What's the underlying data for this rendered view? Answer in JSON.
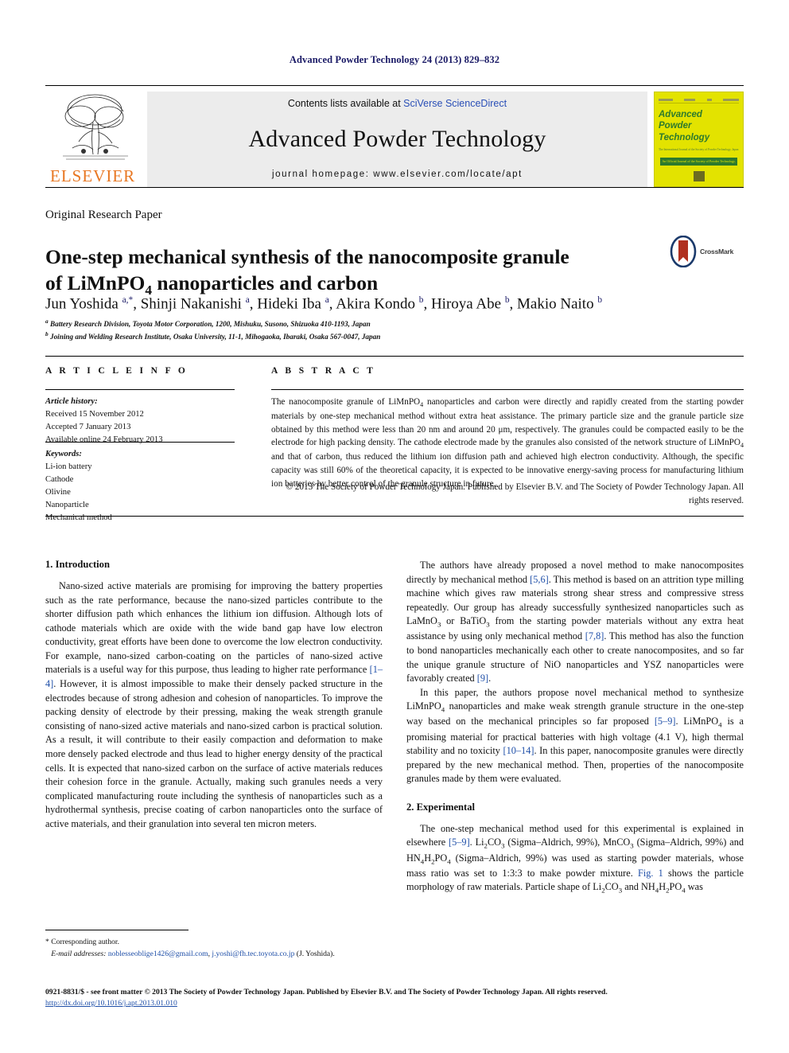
{
  "running_head": "Advanced Powder Technology 24 (2013) 829–832",
  "masthead": {
    "contents_prefix": "Contents lists available at ",
    "contents_link": "SciVerse ScienceDirect",
    "journal_title": "Advanced Powder Technology",
    "homepage": "journal homepage: www.elsevier.com/locate/apt",
    "publisher_logo_text": "ELSEVIER",
    "cover": {
      "title_line1": "Advanced",
      "title_line2": "Powder",
      "title_line3": "Technology",
      "subtitle": "The International Journal of the Society of Powder Technology, Japan",
      "band_text": "An Official Journal of the Society of Powder Technology, Japan"
    }
  },
  "article": {
    "type": "Original Research Paper",
    "title_line1": "One-step mechanical synthesis of the nanocomposite granule",
    "title_line2_a": "of LiMnPO",
    "title_line2_sub": "4",
    "title_line2_b": " nanoparticles and carbon",
    "crossmark_label": "CrossMark",
    "authors": "Jun Yoshida a,*, Shinji Nakanishi a, Hideki Iba a, Akira Kondo b, Hiroya Abe b, Makio Naito b",
    "affiliation_a": "Battery Research Division, Toyota Motor Corporation, 1200, Mishuku, Susono, Shizuoka 410-1193, Japan",
    "affiliation_b": "Joining and Welding Research Institute, Osaka University, 11-1, Mihogaoka, Ibaraki, Osaka 567-0047, Japan"
  },
  "info": {
    "heading": "A R T I C L E  I N F O",
    "history_label": "Article history:",
    "received": "Received 15 November 2012",
    "accepted": "Accepted 7 January 2013",
    "available": "Available online 24 February 2013",
    "keywords_label": "Keywords:",
    "keywords": [
      "Li-ion battery",
      "Cathode",
      "Olivine",
      "Nanoparticle",
      "Mechanical method"
    ]
  },
  "abstract": {
    "heading": "A B S T R A C T",
    "text_part1": "The nanocomposite granule of LiMnPO",
    "text_sub1": "4",
    "text_part2": " nanoparticles and carbon were directly and rapidly created from the starting powder materials by one-step mechanical method without extra heat assistance. The primary particle size and the granule particle size obtained by this method were less than 20 nm and around 20 μm, respectively. The granules could be compacted easily to be the electrode for high packing density. The cathode electrode made by the granules also consisted of the network structure of LiMnPO",
    "text_sub2": "4",
    "text_part3": " and that of carbon, thus reduced the lithium ion diffusion path and achieved high electron conductivity. Although, the specific capacity was still 60% of the theoretical capacity, it is expected to be innovative energy-saving process for manufacturing lithium ion batteries by better control of the granule structure in future.",
    "copyright": "© 2013 The Society of Powder Technology Japan. Published by Elsevier B.V. and The Society of Powder Technology Japan. All rights reserved."
  },
  "body": {
    "section1_heading": "1. Introduction",
    "section1_para1_a": "Nano-sized active materials are promising for improving the battery properties such as the rate performance, because the nano-sized particles contribute to the shorter diffusion path which enhances the lithium ion diffusion. Although lots of cathode materials which are oxide with the wide band gap have low electron conductivity, great efforts have been done to overcome the low electron conductivity. For example, nano-sized carbon-coating on the particles of nano-sized active materials is a useful way for this purpose, thus leading to higher rate performance ",
    "section1_para1_ref": "[1–4]",
    "section1_para1_b": ". However, it is almost impossible to make their densely packed structure in the electrodes because of strong adhesion and cohesion of nanoparticles. To improve the packing density of electrode by their pressing, making the weak strength granule consisting of nano-sized active materials and nano-sized carbon is practical solution. As a result, it will contribute to their easily compaction and deformation to make more densely packed electrode and thus lead to higher energy density of the practical cells. It is expected that nano-sized carbon on the surface of active materials reduces their cohesion force in the granule. Actually, making such granules needs a very complicated manufacturing route including the synthesis of nanoparticles such as a hydrothermal synthesis, precise coating of carbon nanoparticles onto the surface of active materials, and their granulation into several ten micron meters.",
    "right_para1_a": "The authors have already proposed a novel method to make nanocomposites directly by mechanical method ",
    "right_para1_ref1": "[5,6]",
    "right_para1_b": ". This method is based on an attrition type milling machine which gives raw materials strong shear stress and compressive stress repeatedly. Our group has already successfully synthesized nanoparticles such as LaMnO",
    "right_para1_sub1": "3",
    "right_para1_c": " or BaTiO",
    "right_para1_sub2": "3",
    "right_para1_d": " from the starting powder materials without any extra heat assistance by using only mechanical method ",
    "right_para1_ref2": "[7,8]",
    "right_para1_e": ". This method has also the function to bond nanoparticles mechanically each other to create nanocomposites, and so far the unique granule structure of NiO nanoparticles and YSZ nanoparticles were favorably created ",
    "right_para1_ref3": "[9]",
    "right_para1_f": ".",
    "right_para2_a": "In this paper, the authors propose novel mechanical method to synthesize LiMnPO",
    "right_para2_sub1": "4",
    "right_para2_b": " nanoparticles and make weak strength granule structure in the one-step way based on the mechanical principles so far proposed ",
    "right_para2_ref1": "[5–9]",
    "right_para2_c": ". LiMnPO",
    "right_para2_sub2": "4",
    "right_para2_d": " is a promising material for practical batteries with high voltage (4.1 V), high thermal stability and no toxicity ",
    "right_para2_ref2": "[10–14]",
    "right_para2_e": ". In this paper, nanocomposite granules were directly prepared by the new mechanical method. Then, properties of the nanocomposite granules made by them were evaluated.",
    "section2_heading": "2. Experimental",
    "section2_para1_a": "The one-step mechanical method used for this experimental is explained in elsewhere ",
    "section2_para1_ref1": "[5–9]",
    "section2_para1_b": ". Li",
    "section2_para1_sub1": "2",
    "section2_para1_c": "CO",
    "section2_para1_sub2": "3",
    "section2_para1_d": " (Sigma–Aldrich, 99%), MnCO",
    "section2_para1_sub3": "3",
    "section2_para1_e": " (Sigma–Aldrich, 99%) and HN",
    "section2_para1_sub4": "4",
    "section2_para1_f": "H",
    "section2_para1_sub5": "2",
    "section2_para1_g": "PO",
    "section2_para1_sub6": "4",
    "section2_para1_h": " (Sigma–Aldrich, 99%) was used as starting powder materials, whose mass ratio was set to 1:3:3 to make powder mixture. ",
    "section2_para1_ref2": "Fig. 1",
    "section2_para1_i": " shows the particle morphology of raw materials. Particle shape of Li",
    "section2_para1_sub7": "2",
    "section2_para1_j": "CO",
    "section2_para1_sub8": "3",
    "section2_para1_k": " and NH",
    "section2_para1_sub9": "4",
    "section2_para1_l": "H",
    "section2_para1_sub10": "2",
    "section2_para1_m": "PO",
    "section2_para1_sub11": "4",
    "section2_para1_n": " was"
  },
  "footnotes": {
    "corresponding": "* Corresponding author.",
    "email_label": "E-mail addresses:",
    "email1": "noblesseoblige1426@gmail.com",
    "email_sep": ", ",
    "email2": "j.yoshi@fh.tec.toyota.co.jp",
    "email_author": "(J. Yoshida)."
  },
  "colophon": {
    "line": "0921-8831/$ - see front matter © 2013 The Society of Powder Technology Japan. Published by Elsevier B.V. and The Society of Powder Technology Japan. All rights reserved.",
    "doi": "http://dx.doi.org/10.1016/j.apt.2013.01.010"
  },
  "colors": {
    "link": "#1f4fa8",
    "elsevier_orange": "#E87722",
    "cover_yellow": "#e3e300",
    "cover_green": "#2d7a2d",
    "running_head": "#1a1a66"
  }
}
